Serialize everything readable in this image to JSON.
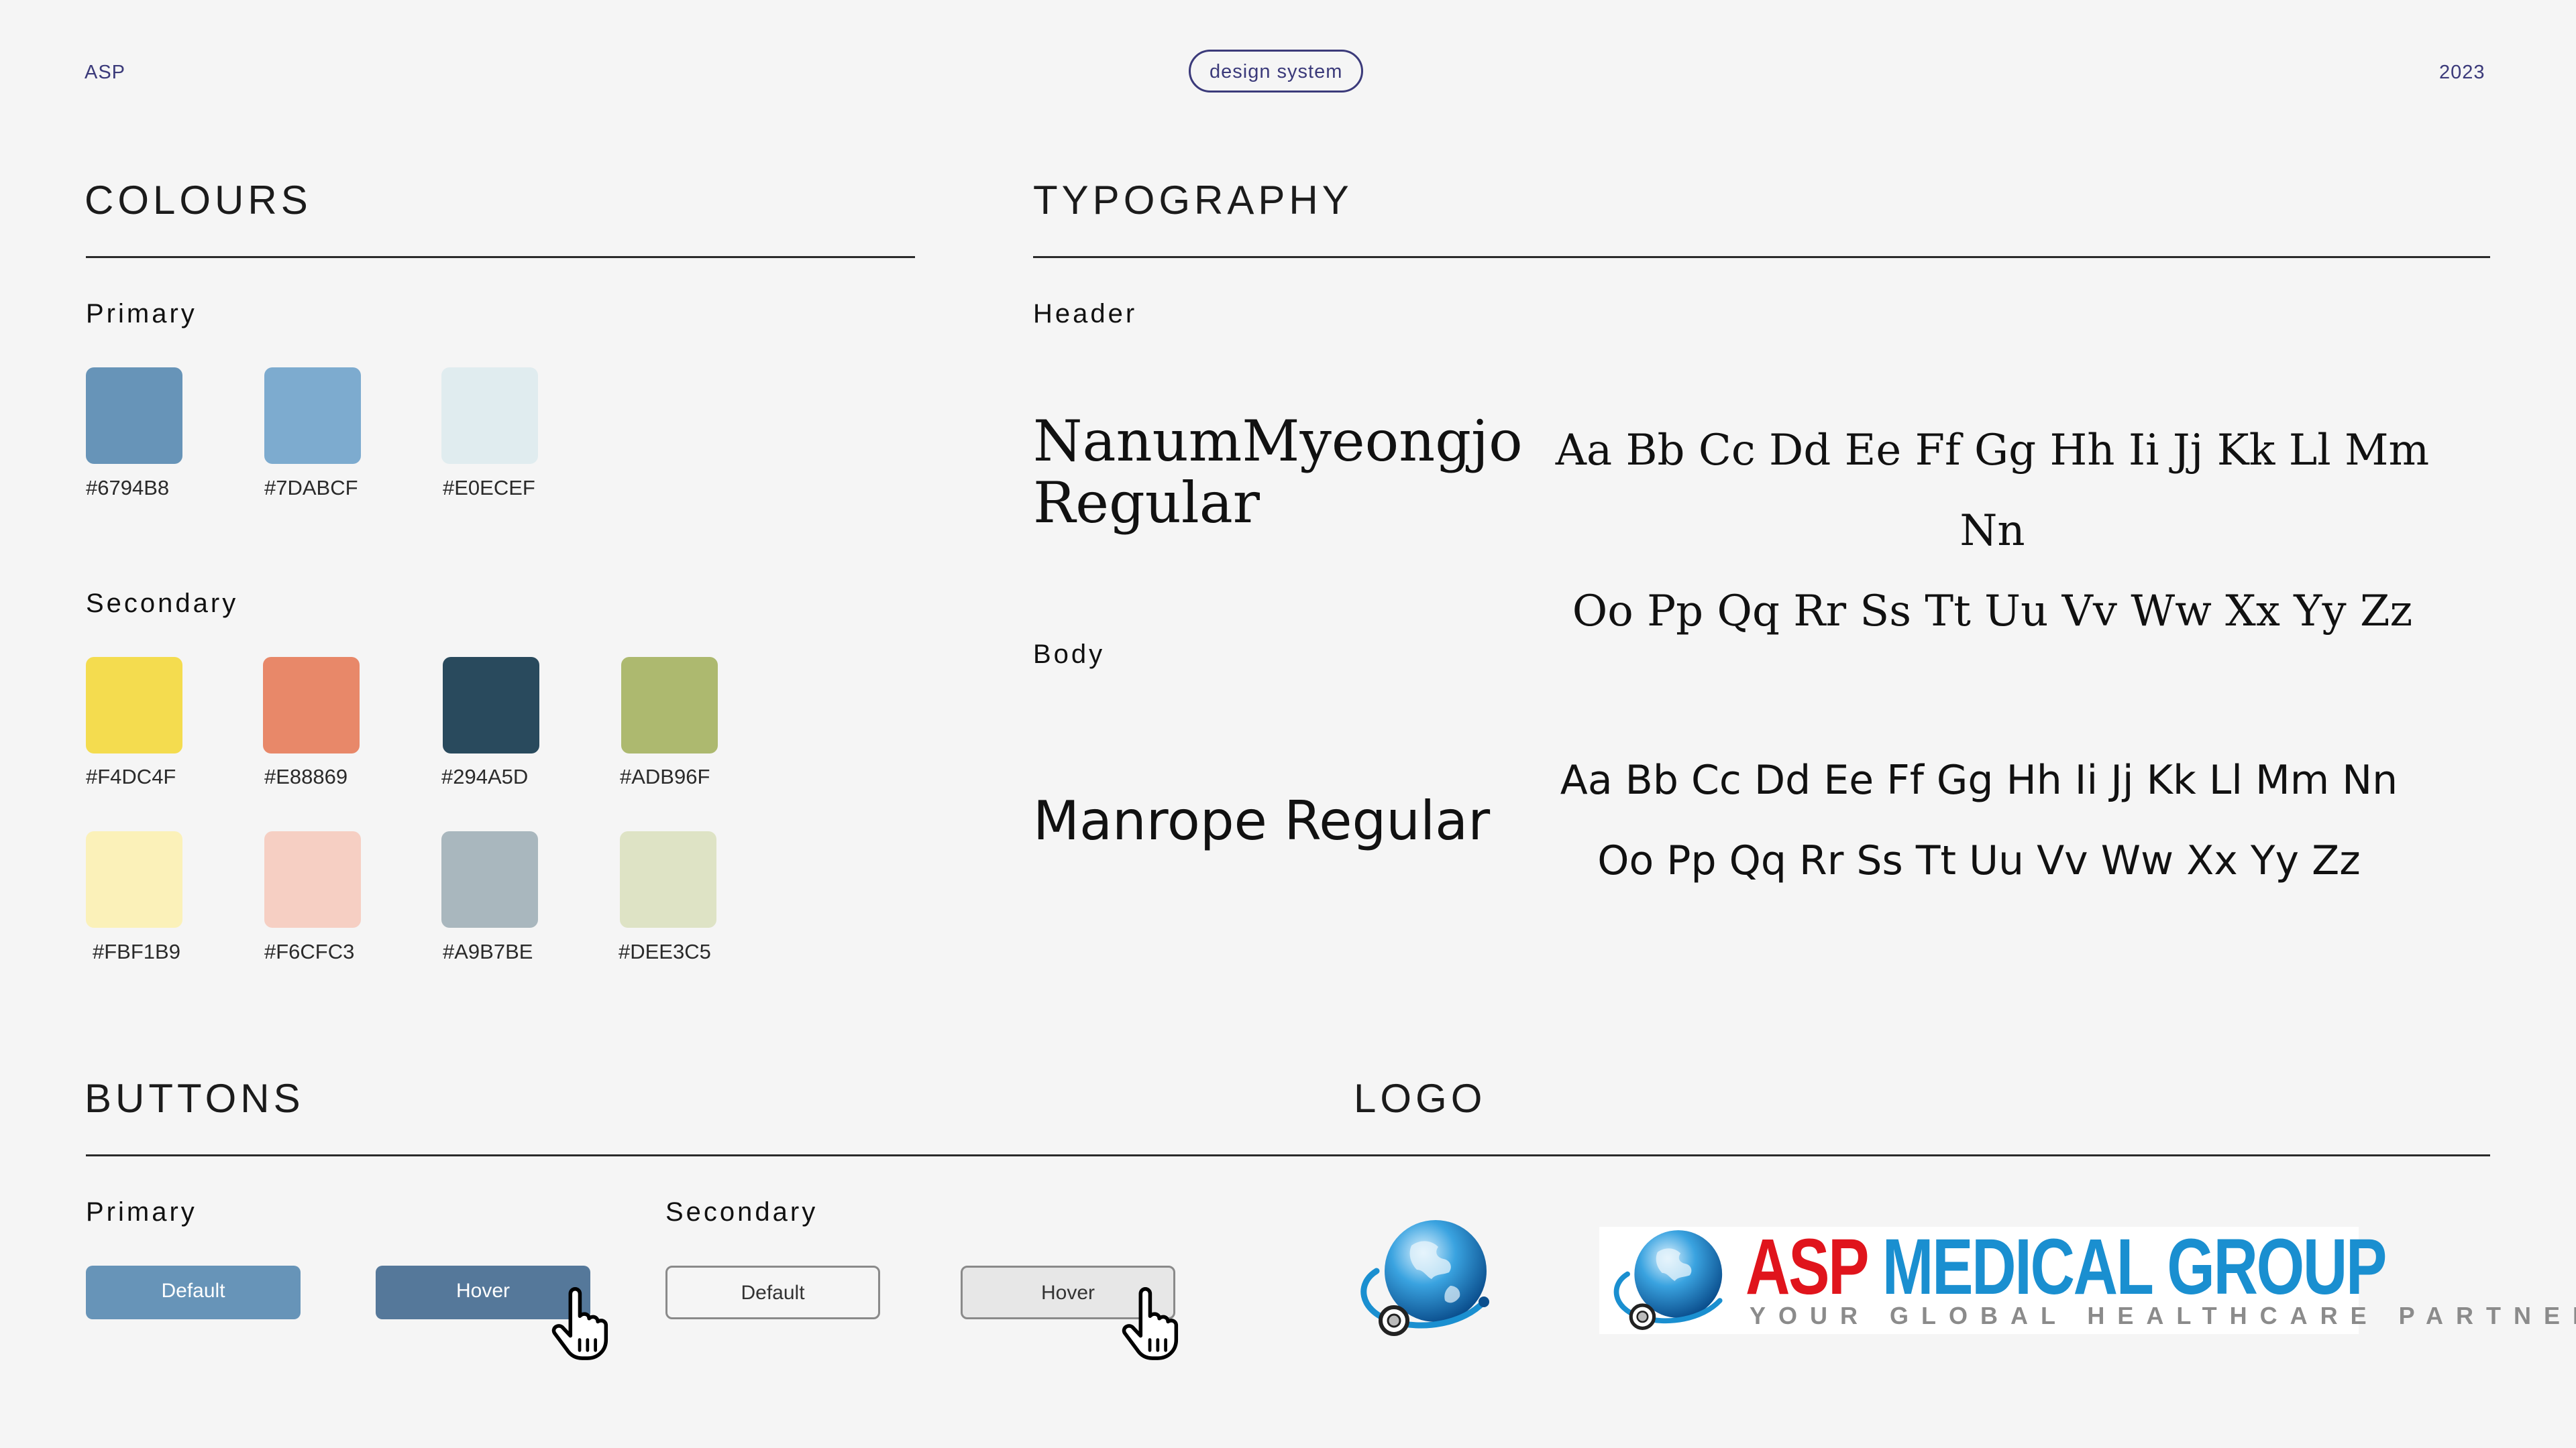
{
  "header": {
    "brand": "ASP",
    "tag": "design system",
    "year": "2023"
  },
  "colours": {
    "title": "COLOURS",
    "primary_label": "Primary",
    "primary": [
      {
        "hex": "#6794B8",
        "color": "#6794B8"
      },
      {
        "hex": "#7DABCF",
        "color": "#7DABCF"
      },
      {
        "hex": "#E0ECEF",
        "color": "#E0ECEF"
      }
    ],
    "secondary_label": "Secondary",
    "secondary": [
      {
        "hex": "#F4DC4F",
        "color": "#F4DC4F"
      },
      {
        "hex": "#E88869",
        "color": "#E88869"
      },
      {
        "hex": "#294A5D",
        "color": "#294A5D"
      },
      {
        "hex": "#ADB96F",
        "color": "#ADB96F"
      },
      {
        "hex": "#FBF1B9",
        "color": "#FBF1B9"
      },
      {
        "hex": "#F6CFC3",
        "color": "#F6CFC3"
      },
      {
        "hex": "#A9B7BE",
        "color": "#A9B7BE"
      },
      {
        "hex": "#DEE3C5",
        "color": "#DEE3C5"
      }
    ]
  },
  "typography": {
    "title": "TYPOGRAPHY",
    "header_label": "Header",
    "header_font_line1": "NanumMyeongjo",
    "header_font_line2": "Regular",
    "header_sample_line1": "Aa Bb Cc Dd Ee Ff Gg Hh Ii Jj Kk Ll Mm Nn",
    "header_sample_line2": "Oo Pp Qq Rr Ss Tt Uu Vv Ww Xx Yy Zz",
    "body_label": "Body",
    "body_font": "Manrope Regular",
    "body_sample_line1": "Aa Bb Cc Dd Ee Ff Gg Hh Ii Jj Kk Ll Mm Nn",
    "body_sample_line2": "Oo Pp Qq Rr Ss Tt Uu Vv Ww Xx Yy Zz"
  },
  "buttons": {
    "title": "BUTTONS",
    "primary_label": "Primary",
    "secondary_label": "Secondary",
    "default_label": "Default",
    "hover_label": "Hover"
  },
  "logo": {
    "title": "LOGO",
    "wordmark": "ASP MEDICAL GROUP",
    "tagline": "YOUR GLOBAL HEALTHCARE PARTNER",
    "colors": {
      "red": "#e0141c",
      "blue": "#1a8fd0"
    }
  }
}
